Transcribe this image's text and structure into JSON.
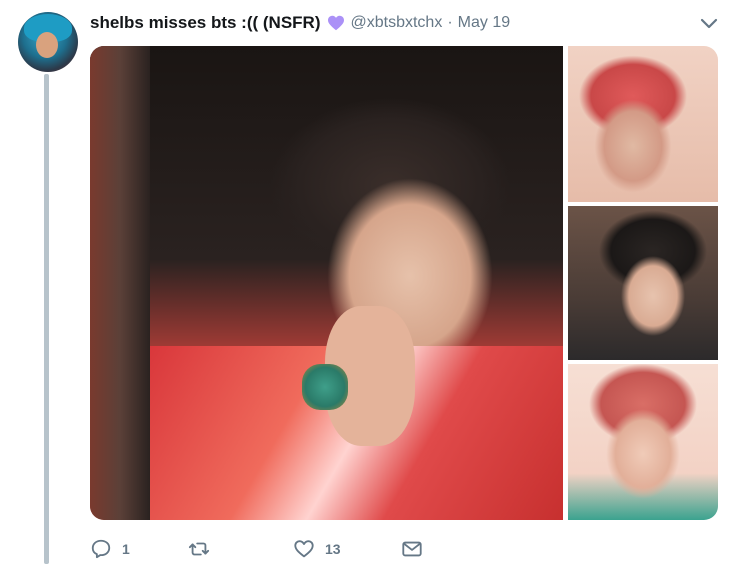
{
  "tweet": {
    "display_name": "shelbs misses bts :(( (NSFR)",
    "handle": "@xbtsbxtchx",
    "separator": "·",
    "date": "May 19",
    "emoji_icon": "purple-heart-icon",
    "photos": [
      {
        "label": "main-photo"
      },
      {
        "label": "photo-top-right"
      },
      {
        "label": "photo-middle-right"
      },
      {
        "label": "photo-bottom-right"
      }
    ],
    "actions": {
      "reply": {
        "icon": "reply-icon",
        "count": "1"
      },
      "retweet": {
        "icon": "retweet-icon",
        "count": ""
      },
      "like": {
        "icon": "like-icon",
        "count": "13"
      },
      "dm": {
        "icon": "direct-message-icon"
      }
    }
  },
  "colors": {
    "name_text": "#14171a",
    "meta_text": "#657786",
    "thread_line": "#aab8c2",
    "heart": "#ab91f7"
  }
}
